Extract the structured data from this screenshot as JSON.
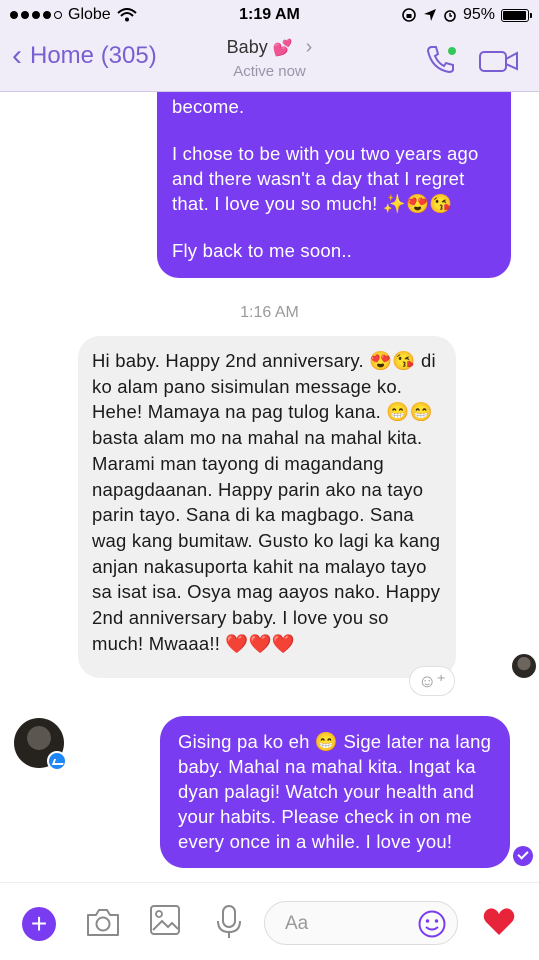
{
  "status_bar": {
    "carrier": "Globe",
    "time": "1:19 AM",
    "battery": "95%"
  },
  "header": {
    "back_label": "Home (305)",
    "contact_name": "Baby",
    "contact_emoji": "💕",
    "contact_status": "Active now"
  },
  "messages": {
    "outgoing_1": {
      "line_0": "become.",
      "para_1": "I chose to be with you two years ago\nand there wasn't a day that I regret\nthat. I love you so much! ✨😍😘",
      "para_2": "Fly back to me soon.."
    },
    "timestamp": "1:16 AM",
    "incoming_1": "Hi baby. Happy 2nd anniversary. 😍😘 di ko alam pano sisimulan message ko. Hehe! Mamaya na pag tulog kana. 😁😁 basta alam mo na mahal na mahal kita. Marami man tayong di magandang napagdaanan. Happy parin ako na tayo parin tayo. Sana di ka magbago. Sana wag kang bumitaw. Gusto ko lagi ka kang anjan  nakasuporta kahit na malayo tayo sa isat isa. Osya mag aayos nako. Happy 2nd anniversary baby. I love you so much! Mwaaa!! ❤️❤️❤️",
    "outgoing_2": "Gising pa ko eh 😁 Sige later na lang baby. Mahal na mahal kita. Ingat ka dyan palagi! Watch your health and your habits. Please check in on me every once in a while. I love you!"
  },
  "composer": {
    "placeholder": "Aa",
    "like_emoji": "❤️"
  },
  "colors": {
    "accent": "#7a3cf0",
    "header_bg": "#f0edf8",
    "incoming_bg": "#f1f0f0"
  },
  "icons": [
    "wifi-icon",
    "location-icon",
    "alarm-icon",
    "phone-icon",
    "video-camera-icon",
    "plus-icon",
    "camera-icon",
    "gallery-icon",
    "microphone-icon",
    "smiley-icon",
    "heart-icon"
  ]
}
